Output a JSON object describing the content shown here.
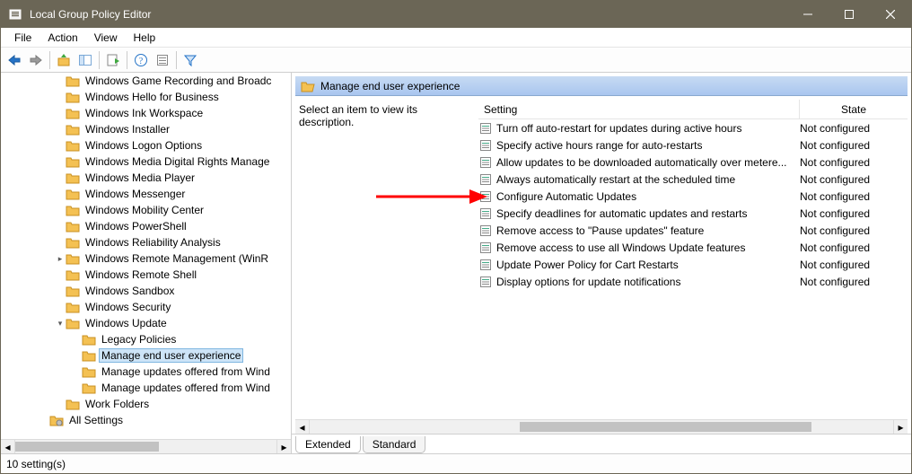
{
  "window": {
    "title": "Local Group Policy Editor"
  },
  "menubar": {
    "items": [
      "File",
      "Action",
      "View",
      "Help"
    ]
  },
  "tree": {
    "items": [
      {
        "indent": 3,
        "expander": "",
        "icon": "folder",
        "label": "Windows Game Recording and Broadc",
        "selected": false
      },
      {
        "indent": 3,
        "expander": "",
        "icon": "folder",
        "label": "Windows Hello for Business",
        "selected": false
      },
      {
        "indent": 3,
        "expander": "",
        "icon": "folder",
        "label": "Windows Ink Workspace",
        "selected": false
      },
      {
        "indent": 3,
        "expander": "",
        "icon": "folder",
        "label": "Windows Installer",
        "selected": false
      },
      {
        "indent": 3,
        "expander": "",
        "icon": "folder",
        "label": "Windows Logon Options",
        "selected": false
      },
      {
        "indent": 3,
        "expander": "",
        "icon": "folder",
        "label": "Windows Media Digital Rights Manage",
        "selected": false
      },
      {
        "indent": 3,
        "expander": "",
        "icon": "folder",
        "label": "Windows Media Player",
        "selected": false
      },
      {
        "indent": 3,
        "expander": "",
        "icon": "folder",
        "label": "Windows Messenger",
        "selected": false
      },
      {
        "indent": 3,
        "expander": "",
        "icon": "folder",
        "label": "Windows Mobility Center",
        "selected": false
      },
      {
        "indent": 3,
        "expander": "",
        "icon": "folder",
        "label": "Windows PowerShell",
        "selected": false
      },
      {
        "indent": 3,
        "expander": "",
        "icon": "folder",
        "label": "Windows Reliability Analysis",
        "selected": false
      },
      {
        "indent": 3,
        "expander": ">",
        "icon": "folder",
        "label": "Windows Remote Management (WinR",
        "selected": false
      },
      {
        "indent": 3,
        "expander": "",
        "icon": "folder",
        "label": "Windows Remote Shell",
        "selected": false
      },
      {
        "indent": 3,
        "expander": "",
        "icon": "folder",
        "label": "Windows Sandbox",
        "selected": false
      },
      {
        "indent": 3,
        "expander": "",
        "icon": "folder",
        "label": "Windows Security",
        "selected": false
      },
      {
        "indent": 3,
        "expander": "v",
        "icon": "folder",
        "label": "Windows Update",
        "selected": false
      },
      {
        "indent": 4,
        "expander": "",
        "icon": "folder",
        "label": "Legacy Policies",
        "selected": false
      },
      {
        "indent": 4,
        "expander": "",
        "icon": "folder-open",
        "label": "Manage end user experience",
        "selected": true
      },
      {
        "indent": 4,
        "expander": "",
        "icon": "folder",
        "label": "Manage updates offered from Wind",
        "selected": false
      },
      {
        "indent": 4,
        "expander": "",
        "icon": "folder",
        "label": "Manage updates offered from Wind",
        "selected": false
      },
      {
        "indent": 3,
        "expander": "",
        "icon": "folder",
        "label": "Work Folders",
        "selected": false
      },
      {
        "indent": 2,
        "expander": "",
        "icon": "gear-folder",
        "label": "All Settings",
        "selected": false
      }
    ]
  },
  "right": {
    "header": "Manage end user experience",
    "desc": "Select an item to view its description.",
    "columns": {
      "setting": "Setting",
      "state": "State"
    },
    "rows": [
      {
        "label": "Turn off auto-restart for updates during active hours",
        "state": "Not configured"
      },
      {
        "label": "Specify active hours range for auto-restarts",
        "state": "Not configured"
      },
      {
        "label": "Allow updates to be downloaded automatically over metere...",
        "state": "Not configured"
      },
      {
        "label": "Always automatically restart at the scheduled time",
        "state": "Not configured"
      },
      {
        "label": "Configure Automatic Updates",
        "state": "Not configured"
      },
      {
        "label": "Specify deadlines for automatic updates and restarts",
        "state": "Not configured"
      },
      {
        "label": "Remove access to \"Pause updates\" feature",
        "state": "Not configured"
      },
      {
        "label": "Remove access to use all Windows Update features",
        "state": "Not configured"
      },
      {
        "label": "Update Power Policy for Cart Restarts",
        "state": "Not configured"
      },
      {
        "label": "Display options for update notifications",
        "state": "Not configured"
      }
    ],
    "tabs": {
      "extended": "Extended",
      "standard": "Standard"
    }
  },
  "status": {
    "text": "10 setting(s)"
  }
}
